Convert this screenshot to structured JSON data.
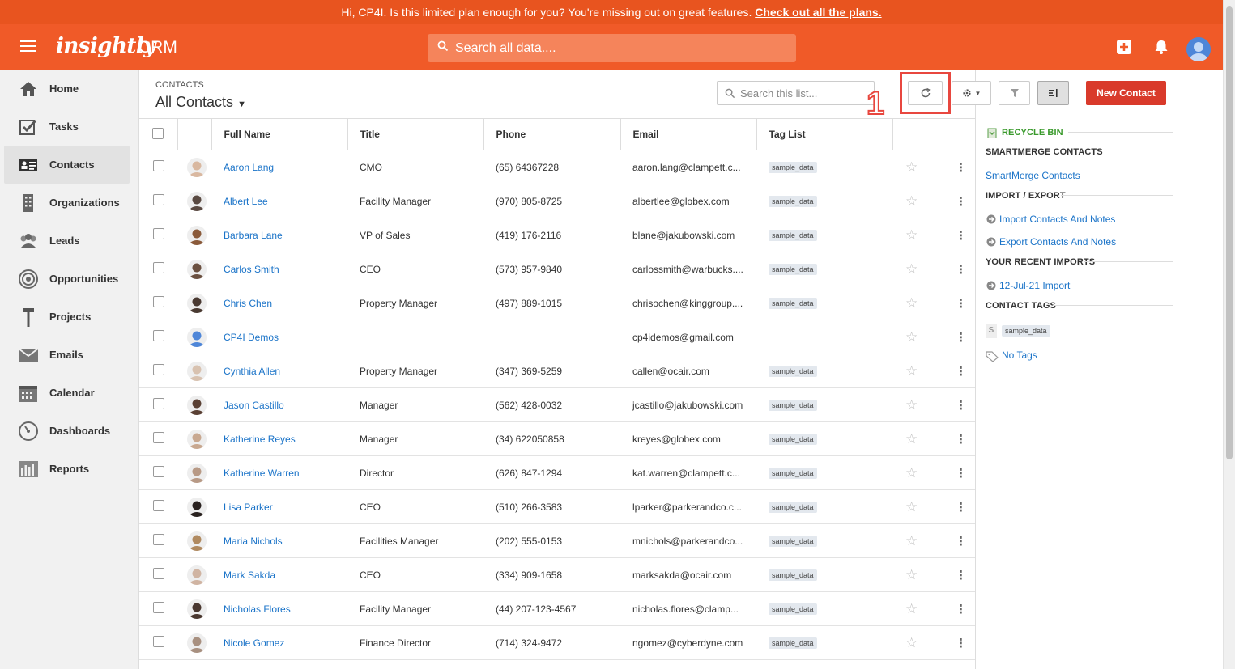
{
  "promo": {
    "text": "Hi, CP4I. Is this limited plan enough for you? You're missing out on great features. ",
    "link": "Check out all the plans."
  },
  "topbar": {
    "logo": "insightly",
    "product": "CRM",
    "search_placeholder": "Search all data...."
  },
  "sidebar": {
    "items": [
      {
        "label": "Home",
        "icon": "home-icon"
      },
      {
        "label": "Tasks",
        "icon": "tasks-icon"
      },
      {
        "label": "Contacts",
        "icon": "contacts-icon",
        "active": true
      },
      {
        "label": "Organizations",
        "icon": "organizations-icon"
      },
      {
        "label": "Leads",
        "icon": "leads-icon"
      },
      {
        "label": "Opportunities",
        "icon": "opportunities-icon"
      },
      {
        "label": "Projects",
        "icon": "projects-icon"
      },
      {
        "label": "Emails",
        "icon": "emails-icon"
      },
      {
        "label": "Calendar",
        "icon": "calendar-icon"
      },
      {
        "label": "Dashboards",
        "icon": "dashboards-icon"
      },
      {
        "label": "Reports",
        "icon": "reports-icon"
      }
    ]
  },
  "header": {
    "crumb": "CONTACTS",
    "view": "All Contacts",
    "list_search_placeholder": "Search this list...",
    "step_marker": "1",
    "new_button": "New Contact"
  },
  "table": {
    "columns": [
      "Full Name",
      "Title",
      "Phone",
      "Email",
      "Tag List"
    ],
    "rows": [
      {
        "name": "Aaron Lang",
        "title": "CMO",
        "phone": "(65) 64367228",
        "email": "aaron.lang@clampett.c...",
        "tag": "sample_data",
        "av": "#d9b8a0"
      },
      {
        "name": "Albert Lee",
        "title": "Facility Manager",
        "phone": "(970) 805-8725",
        "email": "albertlee@globex.com",
        "tag": "sample_data",
        "av": "#5a4a42"
      },
      {
        "name": "Barbara Lane",
        "title": "VP of Sales",
        "phone": "(419) 176-2116",
        "email": "blane@jakubowski.com",
        "tag": "sample_data",
        "av": "#8a5a3a"
      },
      {
        "name": "Carlos Smith",
        "title": "CEO",
        "phone": "(573) 957-9840",
        "email": "carlossmith@warbucks....",
        "tag": "sample_data",
        "av": "#6b5040"
      },
      {
        "name": "Chris Chen",
        "title": "Property Manager",
        "phone": "(497) 889-1015",
        "email": "chrisochen@kinggroup....",
        "tag": "sample_data",
        "av": "#4a3a32"
      },
      {
        "name": "CP4I Demos",
        "title": "",
        "phone": "",
        "email": "cp4idemos@gmail.com",
        "tag": "",
        "av": "#4e86d8"
      },
      {
        "name": "Cynthia Allen",
        "title": "Property Manager",
        "phone": "(347) 369-5259",
        "email": "callen@ocair.com",
        "tag": "sample_data",
        "av": "#d8c2b0"
      },
      {
        "name": "Jason Castillo",
        "title": "Manager",
        "phone": "(562) 428-0032",
        "email": "jcastillo@jakubowski.com",
        "tag": "sample_data",
        "av": "#5a4034"
      },
      {
        "name": "Katherine Reyes",
        "title": "Manager",
        "phone": "(34) 622050858",
        "email": "kreyes@globex.com",
        "tag": "sample_data",
        "av": "#c8a890"
      },
      {
        "name": "Katherine Warren",
        "title": "Director",
        "phone": "(626) 847-1294",
        "email": "kat.warren@clampett.c...",
        "tag": "sample_data",
        "av": "#b89a86"
      },
      {
        "name": "Lisa Parker",
        "title": "CEO",
        "phone": "(510) 266-3583",
        "email": "lparker@parkerandco.c...",
        "tag": "sample_data",
        "av": "#2a2220"
      },
      {
        "name": "Maria Nichols",
        "title": "Facilities Manager",
        "phone": "(202) 555-0153",
        "email": "mnichols@parkerandco...",
        "tag": "sample_data",
        "av": "#b08a60"
      },
      {
        "name": "Mark Sakda",
        "title": "CEO",
        "phone": "(334) 909-1658",
        "email": "marksakda@ocair.com",
        "tag": "sample_data",
        "av": "#d0b4a2"
      },
      {
        "name": "Nicholas Flores",
        "title": "Facility Manager",
        "phone": "(44) 207-123-4567",
        "email": "nicholas.flores@clamp...",
        "tag": "sample_data",
        "av": "#4a3830"
      },
      {
        "name": "Nicole Gomez",
        "title": "Finance Director",
        "phone": "(714) 324-9472",
        "email": "ngomez@cyberdyne.com",
        "tag": "sample_data",
        "av": "#a89080"
      }
    ]
  },
  "panel": {
    "recycle_bin": "RECYCLE BIN",
    "smartmerge_head": "SMARTMERGE CONTACTS",
    "smartmerge_link": "SmartMerge Contacts",
    "import_export_head": "IMPORT / EXPORT",
    "import_link": "Import Contacts And Notes",
    "export_link": "Export Contacts And Notes",
    "recent_head": "YOUR RECENT IMPORTS",
    "recent_link": "12-Jul-21 Import",
    "tags_head": "CONTACT TAGS",
    "tag_letter": "S",
    "tag_name": "sample_data",
    "no_tags": "No Tags"
  },
  "colors": {
    "brand": "#f05a28",
    "promo": "#e8541f",
    "link": "#1a73c8",
    "primary_button": "#d93a2b",
    "highlight": "#e8473f"
  }
}
